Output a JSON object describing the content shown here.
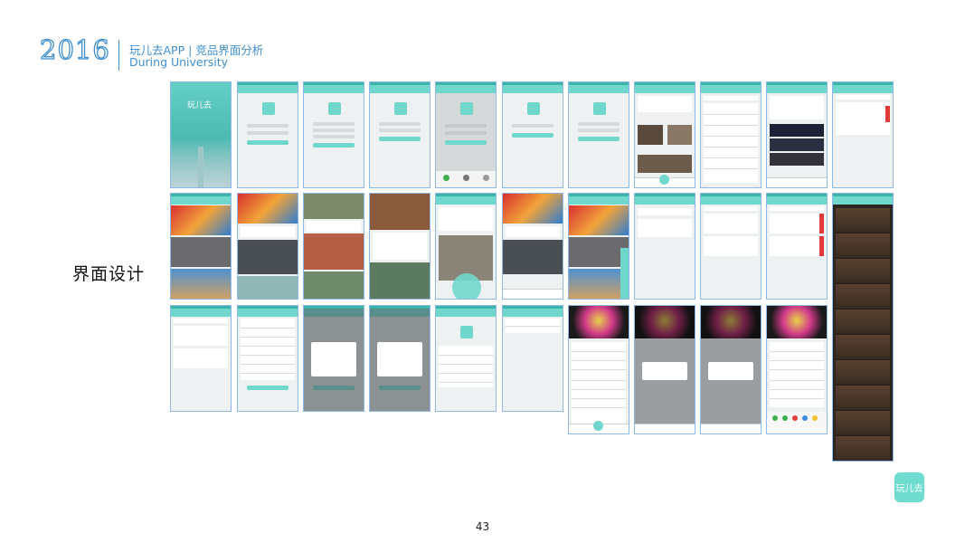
{
  "header": {
    "year": "2016",
    "title": "玩儿去APP | 竞品界面分析",
    "subtitle": "During University"
  },
  "section_title": "界面设计",
  "page_number": "43",
  "badge": "玩儿去",
  "splash_label": "玩儿去",
  "colors": {
    "brand_blue": "#3f8fcf",
    "accent_teal": "#6fd7cb",
    "screen_border": "#8fb7e8"
  }
}
